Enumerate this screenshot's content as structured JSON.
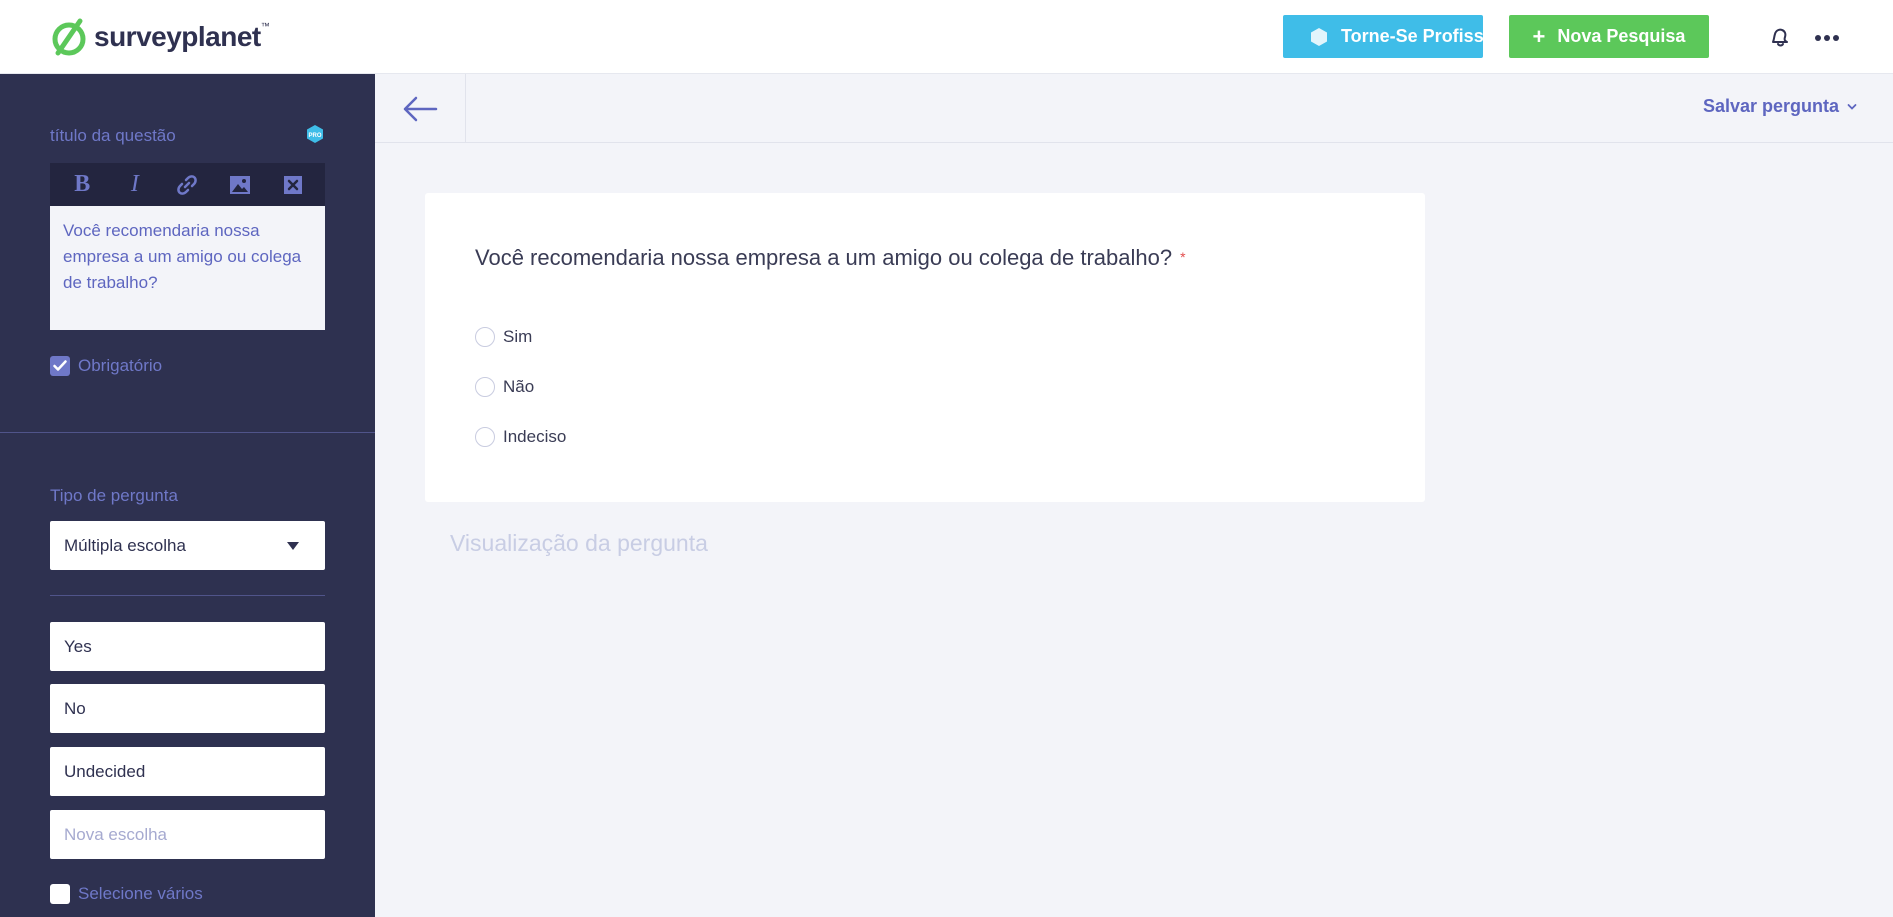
{
  "header": {
    "logo_text": "surveyplanet",
    "logo_tm": "™",
    "pro_button_label": "Torne-Se Profissional",
    "new_survey_label": "Nova Pesquisa",
    "new_survey_icon": "plus-icon",
    "notification_icon": "bell-icon",
    "more_icon": "more-icon"
  },
  "sidebar": {
    "question_title_label": "título da questão",
    "pro_badge": "PRO",
    "toolbar": {
      "bold": "B",
      "italic": "I",
      "link_icon": "link-icon",
      "image_icon": "image-icon",
      "clear_icon": "clear-format-icon"
    },
    "question_text": "Você recomendaria nossa empresa a um amigo ou colega de trabalho?",
    "required_label": "Obrigatório",
    "required_checked": true,
    "question_type_label": "Tipo de pergunta",
    "question_type_value": "Múltipla escolha",
    "choices": [
      "Yes",
      "No",
      "Undecided"
    ],
    "new_choice_placeholder": "Nova escolha",
    "multi_select_label": "Selecione vários",
    "multi_select_checked": false
  },
  "subbar": {
    "back_icon": "arrow-left-icon",
    "save_label": "Salvar pergunta"
  },
  "preview": {
    "question": "Você recomendaria nossa empresa a um amigo ou colega de trabalho?",
    "required_mark": "*",
    "options": [
      "Sim",
      "Não",
      "Indeciso"
    ],
    "caption": "Visualização da pergunta"
  },
  "colors": {
    "sidebar_bg": "#2e3150",
    "accent": "#6f78c8",
    "pro_blue": "#3fbde8",
    "new_green": "#5cc85a",
    "required_red": "#e24c4c"
  }
}
